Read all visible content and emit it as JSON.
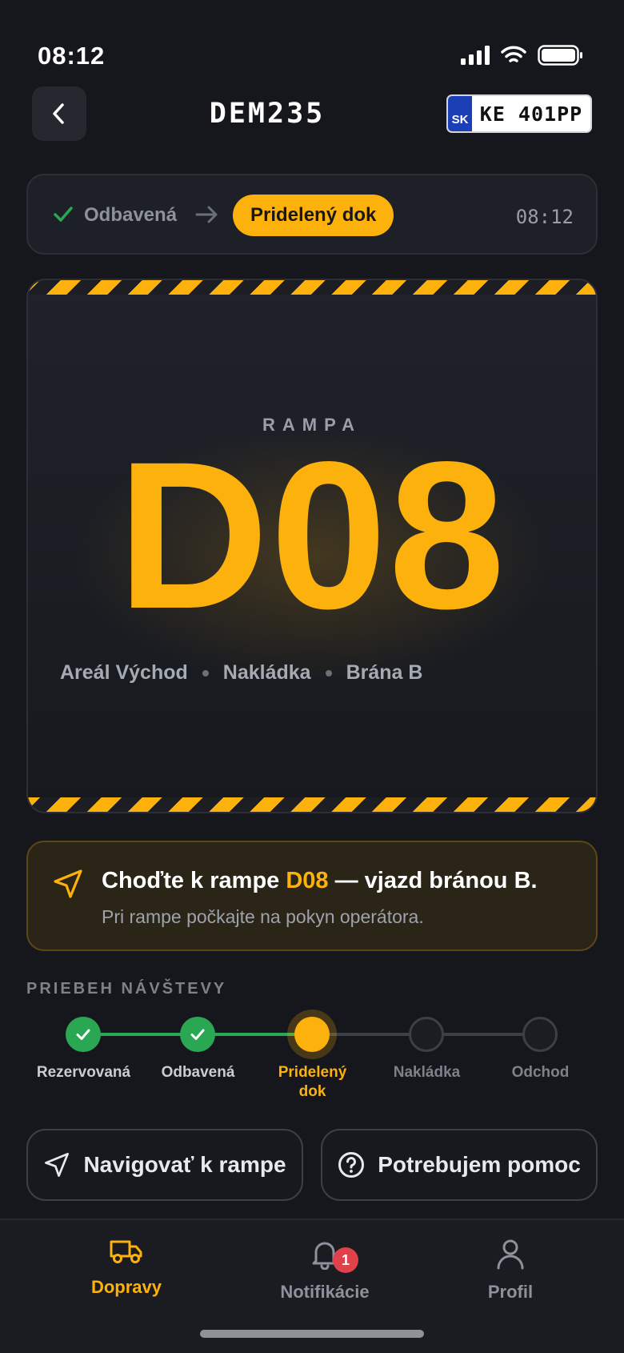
{
  "status_bar": {
    "time": "08:12"
  },
  "header": {
    "title": "DEM235",
    "plate_country": "SK",
    "plate_number": "KE 401PP"
  },
  "status": {
    "previous": "Odbavená",
    "current": "Pridelený dok",
    "time": "08:12"
  },
  "rampa": {
    "label": "RAMPA",
    "code": "D08",
    "meta": [
      "Areál Východ",
      "Nakládka",
      "Brána B"
    ]
  },
  "instruction": {
    "title_before": "Choďte k rampe ",
    "title_highlight": "D08",
    "title_after": " — vjazd bránou B.",
    "subtitle": "Pri rampe počkajte na pokyn operátora."
  },
  "progress": {
    "title": "PRIEBEH NÁVŠTEVY",
    "steps": [
      {
        "label": "Rezervovaná",
        "state": "done"
      },
      {
        "label": "Odbavená",
        "state": "done"
      },
      {
        "label": "Pridelený dok",
        "state": "active"
      },
      {
        "label": "Nakládka",
        "state": "todo"
      },
      {
        "label": "Odchod",
        "state": "todo"
      }
    ]
  },
  "actions": {
    "navigate": "Navigovať k rampe",
    "help": "Potrebujem pomoc"
  },
  "tabbar": {
    "items": [
      {
        "label": "Dopravy",
        "icon": "truck-icon",
        "active": true
      },
      {
        "label": "Notifikácie",
        "icon": "bell-icon",
        "active": false,
        "badge": "1"
      },
      {
        "label": "Profil",
        "icon": "user-icon",
        "active": false
      }
    ]
  },
  "colors": {
    "accent": "#fdb10d",
    "success": "#2aa753",
    "badge": "#e0424b",
    "background": "#15171c"
  }
}
